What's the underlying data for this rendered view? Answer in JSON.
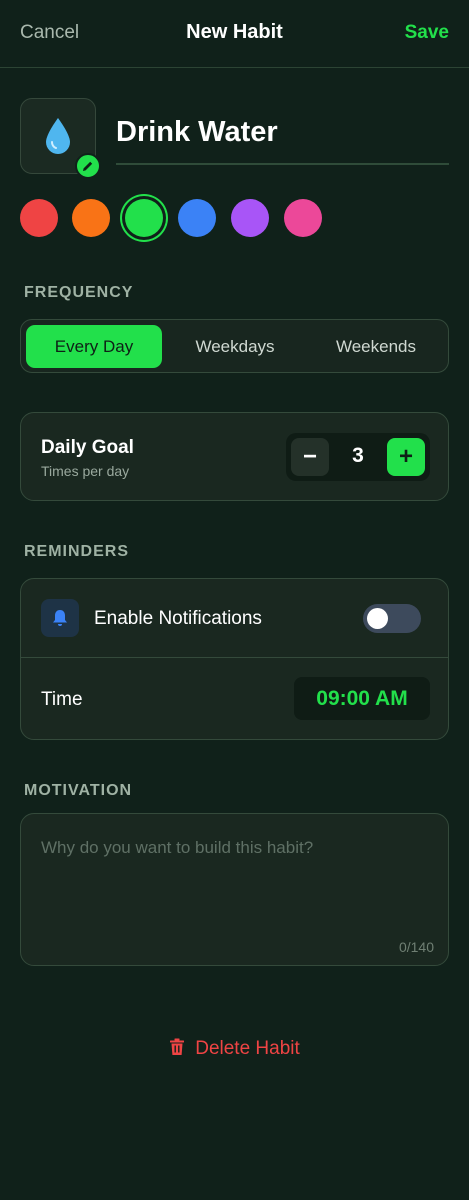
{
  "header": {
    "cancel_label": "Cancel",
    "title": "New Habit",
    "save_label": "Save"
  },
  "habit": {
    "icon": "water-drop-icon",
    "name": "Drink Water"
  },
  "colors": {
    "options": [
      "#ef4444",
      "#f97316",
      "#22e04b",
      "#3b82f6",
      "#a855f7",
      "#ec4899"
    ],
    "selected": "#22e04b"
  },
  "frequency": {
    "label": "FREQUENCY",
    "options": [
      "Every Day",
      "Weekdays",
      "Weekends"
    ],
    "selected": "Every Day"
  },
  "goal": {
    "title": "Daily Goal",
    "subtitle": "Times per day",
    "value": "3",
    "minus_symbol": "−",
    "plus_symbol": "+"
  },
  "reminders": {
    "label": "REMINDERS",
    "notifications_label": "Enable Notifications",
    "notifications_enabled": false,
    "time_label": "Time",
    "time_value": "09:00 AM"
  },
  "motivation": {
    "label": "MOTIVATION",
    "placeholder": "Why do you want to build this habit?",
    "counter": "0/140"
  },
  "delete_label": "Delete Habit",
  "theme": {
    "accent": "#22e04b",
    "danger": "#ef4444",
    "background": "#10211a"
  }
}
